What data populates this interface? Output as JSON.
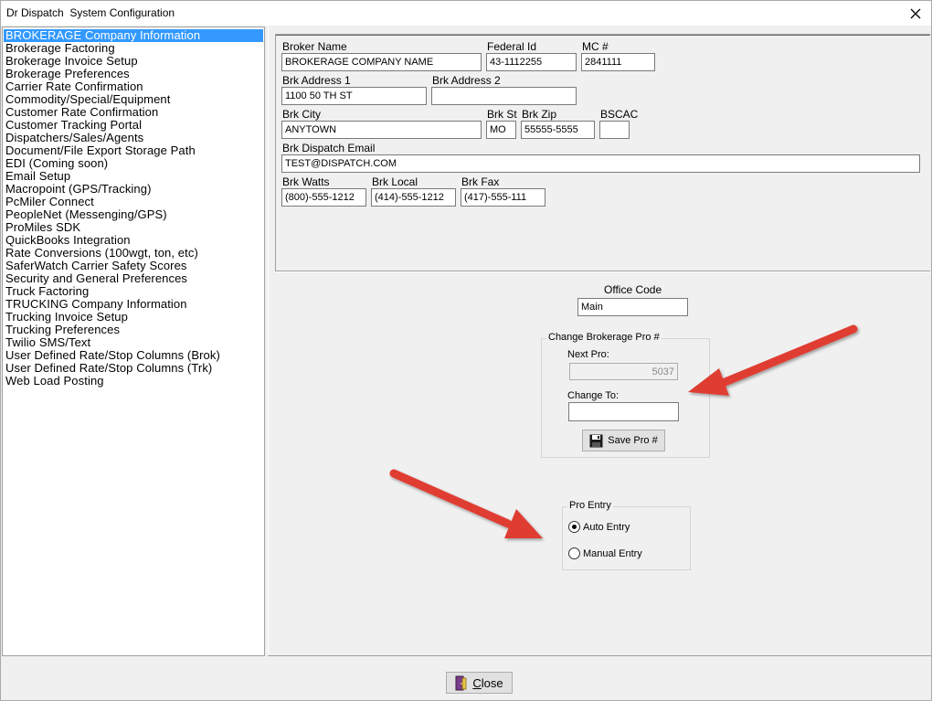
{
  "window": {
    "title": "Dr Dispatch  System Configuration",
    "close_icon": "close-icon"
  },
  "sidebar": {
    "items": [
      {
        "label": "BROKERAGE Company Information",
        "selected": true
      },
      {
        "label": "Brokerage Factoring"
      },
      {
        "label": "Brokerage Invoice Setup"
      },
      {
        "label": "Brokerage Preferences"
      },
      {
        "label": "Carrier Rate Confirmation"
      },
      {
        "label": "Commodity/Special/Equipment"
      },
      {
        "label": "Customer Rate Confirmation"
      },
      {
        "label": "Customer Tracking Portal"
      },
      {
        "label": "Dispatchers/Sales/Agents"
      },
      {
        "label": "Document/File Export Storage Path"
      },
      {
        "label": "EDI (Coming soon)"
      },
      {
        "label": "Email Setup"
      },
      {
        "label": "Macropoint (GPS/Tracking)"
      },
      {
        "label": "PcMiler Connect"
      },
      {
        "label": "PeopleNet (Messenging/GPS)"
      },
      {
        "label": "ProMiles SDK"
      },
      {
        "label": "QuickBooks Integration"
      },
      {
        "label": "Rate Conversions (100wgt, ton, etc)"
      },
      {
        "label": "SaferWatch Carrier Safety Scores"
      },
      {
        "label": "Security and General Preferences"
      },
      {
        "label": "Truck Factoring"
      },
      {
        "label": "TRUCKING Company Information"
      },
      {
        "label": "Trucking Invoice Setup"
      },
      {
        "label": "Trucking Preferences"
      },
      {
        "label": "Twilio SMS/Text"
      },
      {
        "label": "User Defined Rate/Stop Columns (Brok)"
      },
      {
        "label": "User Defined Rate/Stop Columns (Trk)"
      },
      {
        "label": "Web Load Posting"
      }
    ],
    "selected_color": "#3399ff"
  },
  "company": {
    "broker_name_label": "Broker Name",
    "broker_name": "BROKERAGE COMPANY NAME",
    "federal_id_label": "Federal Id",
    "federal_id": "43-1112255",
    "mc_label": "MC #",
    "mc": "2841111",
    "address1_label": "Brk Address 1",
    "address1": "1100 50 TH ST",
    "address2_label": "Brk Address 2",
    "address2": "",
    "city_label": "Brk City",
    "city": "ANYTOWN",
    "state_label": "Brk St",
    "state": "MO",
    "zip_label": "Brk Zip",
    "zip": "55555-5555",
    "bscac_label": "BSCAC",
    "bscac": "",
    "email_label": "Brk Dispatch Email",
    "email": "TEST@DISPATCH.COM",
    "watts_label": "Brk Watts",
    "watts": "(800)-555-1212",
    "local_label": "Brk Local",
    "local": "(414)-555-1212",
    "fax_label": "Brk Fax",
    "fax": "(417)-555-111"
  },
  "office": {
    "label": "Office Code",
    "value": "Main"
  },
  "pro_change": {
    "legend": "Change Brokerage Pro #",
    "next_label": "Next Pro:",
    "next_value": "5037",
    "change_label": "Change To:",
    "change_value": "",
    "save_label": "Save Pro #",
    "save_icon": "floppy-disk-icon"
  },
  "pro_entry": {
    "legend": "Pro Entry",
    "options": [
      {
        "label": "Auto Entry",
        "checked": true
      },
      {
        "label": "Manual Entry",
        "checked": false
      }
    ]
  },
  "footer": {
    "close_letter": "C",
    "close_rest": "lose",
    "close_icon": "door-exit-icon"
  },
  "annotations": {
    "arrow_color": "#e03c31"
  }
}
